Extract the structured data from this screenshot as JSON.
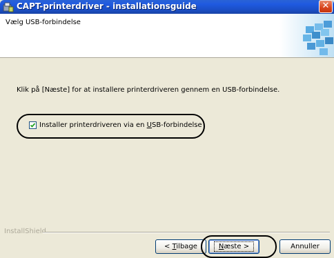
{
  "window": {
    "title": "CAPT-printerdriver - installationsguide",
    "close_glyph": "✕"
  },
  "header": {
    "subtitle": "Vælg USB-forbindelse"
  },
  "main": {
    "instruction": "Klik på [Næste] for at installere printerdriveren gennem en USB-forbindelse.",
    "checkbox": {
      "label_pre": "Installer printerdriveren via en ",
      "label_mnemonic": "U",
      "label_post": "SB-forbindelse",
      "checked": true
    }
  },
  "footer": {
    "brand": "InstallShield",
    "back_button": {
      "pre": "< ",
      "mnemonic": "T",
      "post": "ilbage"
    },
    "next_button": {
      "pre": "",
      "mnemonic": "N",
      "post": "æste >"
    },
    "cancel_button": {
      "label": "Annuller"
    }
  },
  "colors": {
    "titlebar": "#1f5ae0",
    "dialog_bg": "#ece9d8",
    "close": "#d9451c",
    "highlight": "#000000"
  },
  "icons": [
    "setup-app-icon",
    "close-icon",
    "checkmark-icon",
    "printer-header-art"
  ]
}
